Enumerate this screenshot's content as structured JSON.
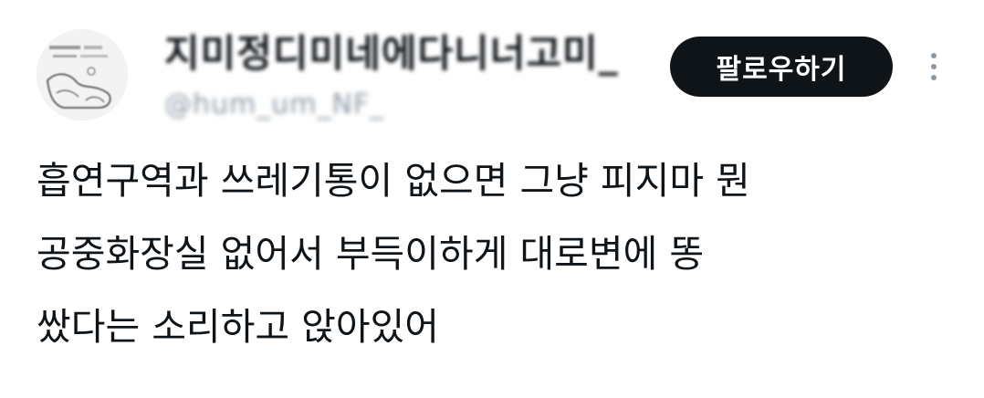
{
  "profile": {
    "display_name": "지미정디미네에다니너고미_",
    "handle": "@hum_um_NF_",
    "avatar_icon": "profile-avatar-sketch"
  },
  "header": {
    "follow_label": "팔로우하기",
    "more_icon": "more-vertical-icon"
  },
  "tweet": {
    "lines": [
      "흡연구역과 쓰레기통이 없으면 그냥 피지마 뭔",
      "공중화장실 없어서 부득이하게 대로변에 똥",
      "쌌다는 소리하고 앉아있어"
    ]
  },
  "colors": {
    "text": "#0f1419",
    "secondary": "#8b98a5",
    "button_bg": "#0f1419",
    "button_text": "#ffffff",
    "background": "#ffffff"
  }
}
